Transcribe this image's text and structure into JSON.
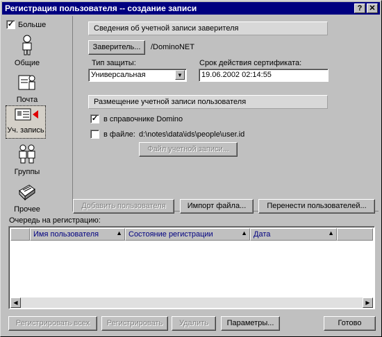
{
  "window": {
    "title": "Регистрация пользователя -- создание записи",
    "help_btn": "?",
    "close_btn": "x"
  },
  "sidebar": {
    "more_label": "Больше",
    "more_checked": true,
    "items": [
      {
        "label": "Общие",
        "icon": "person-icon"
      },
      {
        "label": "Почта",
        "icon": "mail-person-icon"
      },
      {
        "label": "Уч. запись",
        "icon": "id-card-icon",
        "selected": true
      },
      {
        "label": "Группы",
        "icon": "group-icon"
      },
      {
        "label": "Прочее",
        "icon": "other-icon"
      }
    ]
  },
  "certifier": {
    "header": "Сведения об учетной записи заверителя",
    "button": "Заверитель...",
    "value": "/DominoNET",
    "security_type_label": "Тип защиты:",
    "security_type_value": "Универсальная",
    "expiration_label": "Срок действия сертификата:",
    "expiration_value": "19.06.2002 02:14:55"
  },
  "id_storage": {
    "header": "Размещение учетной записи пользователя",
    "in_directory_label": "в справочнике Domino",
    "in_directory_checked": true,
    "in_file_label": "в файле:",
    "in_file_checked": false,
    "file_path": "d:\\notes\\data\\ids\\people\\user.id",
    "file_button": "Файл учетной записи..."
  },
  "actions": {
    "add_user": "Добавить пользователя",
    "import_file": "Импорт файла...",
    "migrate_users": "Перенести пользователей..."
  },
  "queue": {
    "label": "Очередь на регистрацию:",
    "columns": [
      "Имя пользователя",
      "Состояние регистрации",
      "Дата"
    ]
  },
  "footer": {
    "register_all": "Регистрировать всех",
    "register": "Регистрировать",
    "delete": "Удалить",
    "options": "Параметры...",
    "done": "Готово"
  }
}
